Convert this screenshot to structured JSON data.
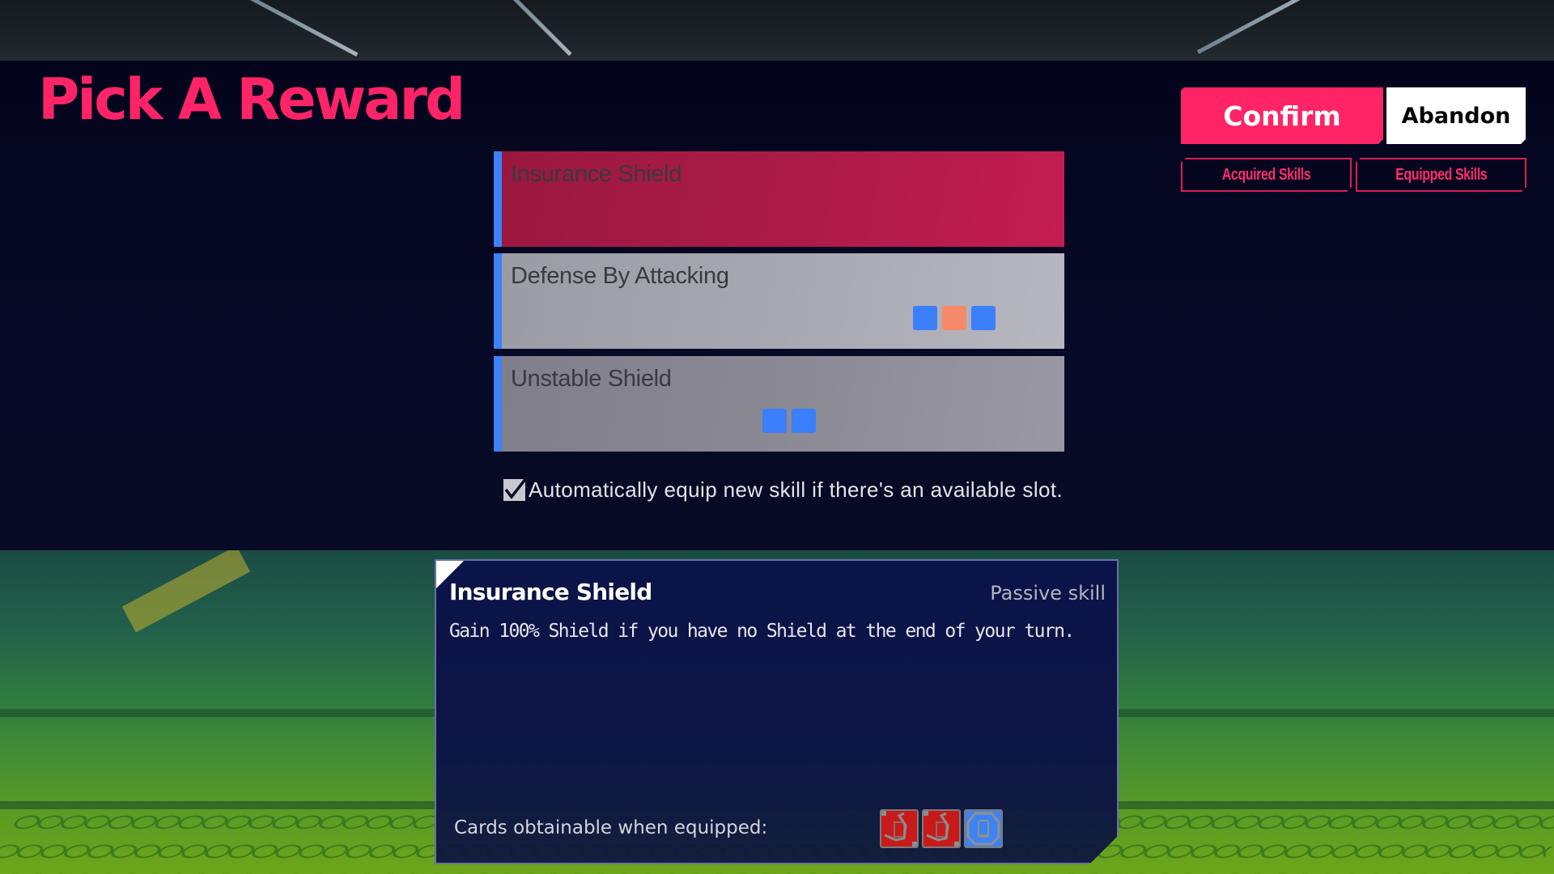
{
  "header": {
    "title": "Pick A Reward",
    "confirm_label": "Confirm",
    "abandon_label": "Abandon",
    "tabs": [
      {
        "label": "Acquired Skills"
      },
      {
        "label": "Equipped Skills"
      }
    ]
  },
  "skills": [
    {
      "name": "Insurance Shield",
      "selected": true,
      "chips": []
    },
    {
      "name": "Defense By Attacking",
      "selected": false,
      "chips": [
        "blue",
        "orange",
        "blue"
      ]
    },
    {
      "name": "Unstable Shield",
      "selected": false,
      "chips": [
        "blue",
        "blue"
      ]
    }
  ],
  "chip_colors": {
    "blue": "#3b7ffb",
    "orange": "#f5896a"
  },
  "auto_equip": {
    "checked": true,
    "label": "Automatically equip new skill if there's an available slot."
  },
  "detail": {
    "title": "Insurance Shield",
    "type": "Passive skill",
    "description": "Gain 100% Shield if you have no Shield at the end of your turn.",
    "cards_label": "Cards obtainable when equipped:",
    "cards": [
      {
        "kind": "attack-card-icon",
        "color": "red"
      },
      {
        "kind": "attack-card-icon",
        "color": "red"
      },
      {
        "kind": "defense-card-icon",
        "color": "blue"
      }
    ]
  },
  "colors": {
    "accent": "#fe2466",
    "selected_card": "#ad1b49",
    "stripe": "#3b82fb"
  }
}
